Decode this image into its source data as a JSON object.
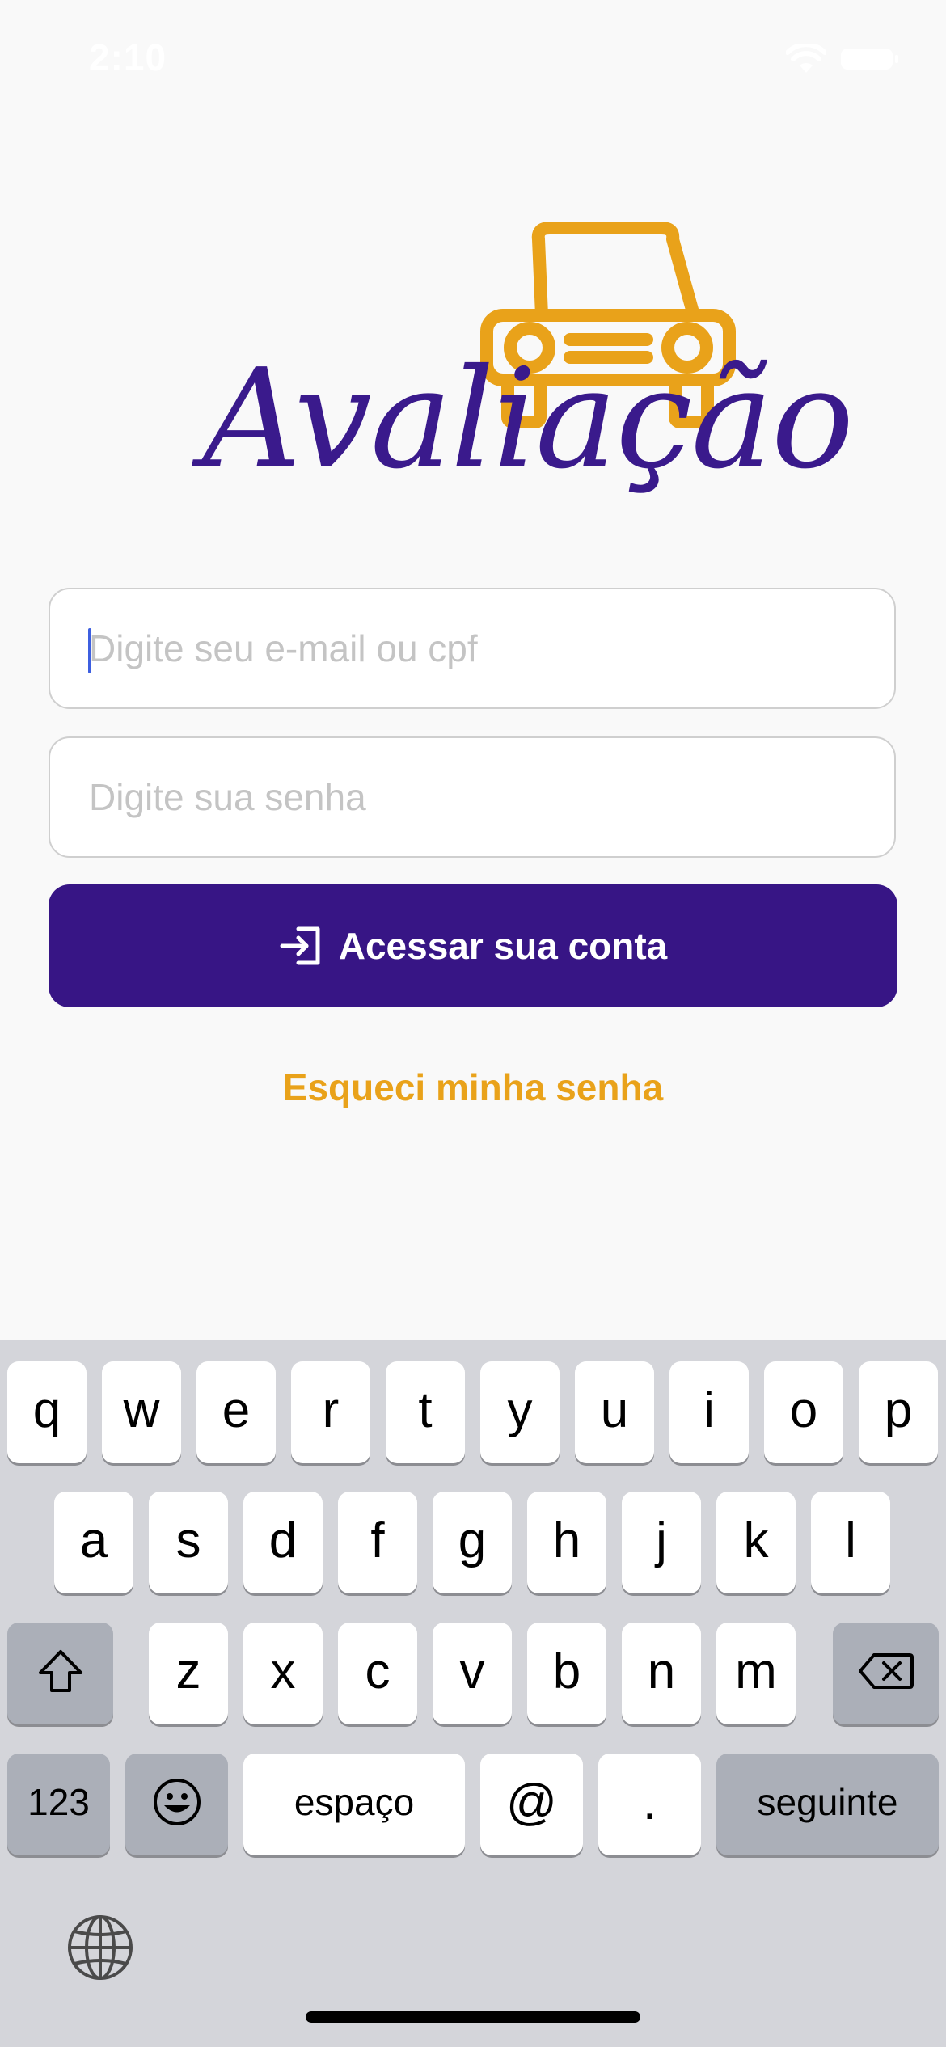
{
  "status_bar": {
    "time": "2:10"
  },
  "logo": {
    "text": "Avaliação",
    "car_color": "#e9a21a",
    "text_color": "#3a1a8c"
  },
  "login_form": {
    "email_placeholder": "Digite seu e-mail ou cpf",
    "email_value": "",
    "password_placeholder": "Digite sua senha",
    "password_value": "",
    "submit_label": "Acessar sua conta",
    "submit_icon": "login-arrow-icon",
    "forgot_password_label": "Esqueci minha senha"
  },
  "colors": {
    "primary": "#371585",
    "accent": "#e9a21a",
    "background": "#f9f9f9"
  },
  "keyboard": {
    "row1": [
      "q",
      "w",
      "e",
      "r",
      "t",
      "y",
      "u",
      "i",
      "o",
      "p"
    ],
    "row2": [
      "a",
      "s",
      "d",
      "f",
      "g",
      "h",
      "j",
      "k",
      "l"
    ],
    "row3": [
      "z",
      "x",
      "c",
      "v",
      "b",
      "n",
      "m"
    ],
    "shift_icon": "shift-icon",
    "delete_icon": "delete-icon",
    "numbers_label": "123",
    "emoji_icon": "emoji-icon",
    "space_label": "espaço",
    "at_label": "@",
    "dot_label": ".",
    "return_label": "seguinte",
    "globe_icon": "globe-icon"
  }
}
